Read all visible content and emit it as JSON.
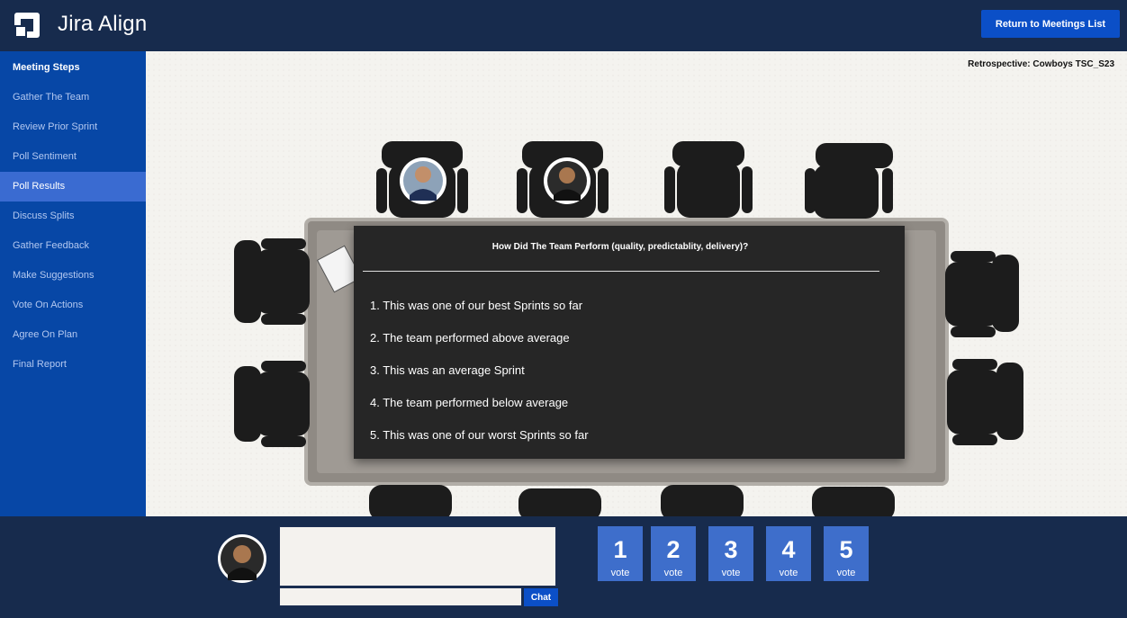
{
  "header": {
    "brand": "Jira Align",
    "return_button": "Return to Meetings List"
  },
  "sidebar": {
    "title": "Meeting Steps",
    "items": [
      {
        "label": "Gather The Team"
      },
      {
        "label": "Review Prior Sprint"
      },
      {
        "label": "Poll Sentiment"
      },
      {
        "label": "Poll Results",
        "active": true
      },
      {
        "label": "Discuss Splits"
      },
      {
        "label": "Gather Feedback"
      },
      {
        "label": "Make Suggestions"
      },
      {
        "label": "Vote On Actions"
      },
      {
        "label": "Agree On Plan"
      },
      {
        "label": "Final Report"
      }
    ]
  },
  "meeting": {
    "title": "Retrospective: Cowboys TSC_S23"
  },
  "poll": {
    "question": "How Did The Team Perform (quality, predictablity, delivery)?",
    "options": [
      "1. This was one of our best Sprints so far",
      "2. The team performed above average",
      "3. This was an average Sprint",
      "4. The team performed below average",
      "5. This was one of our worst Sprints so far"
    ]
  },
  "chat": {
    "button": "Chat"
  },
  "votes": [
    {
      "num": "1",
      "label": "vote"
    },
    {
      "num": "2",
      "label": "vote"
    },
    {
      "num": "3",
      "label": "vote"
    },
    {
      "num": "4",
      "label": "vote"
    },
    {
      "num": "5",
      "label": "vote"
    }
  ],
  "colors": {
    "navy": "#172b4d",
    "sidebar_blue": "#0747a6",
    "active_step": "#3a6bd1",
    "button_blue": "#0b4fc7",
    "vote_blue": "#3e6ecb",
    "poll_bg": "#262626"
  },
  "icons": {
    "logo": "jira-align-logo",
    "avatar": "user-avatar"
  }
}
